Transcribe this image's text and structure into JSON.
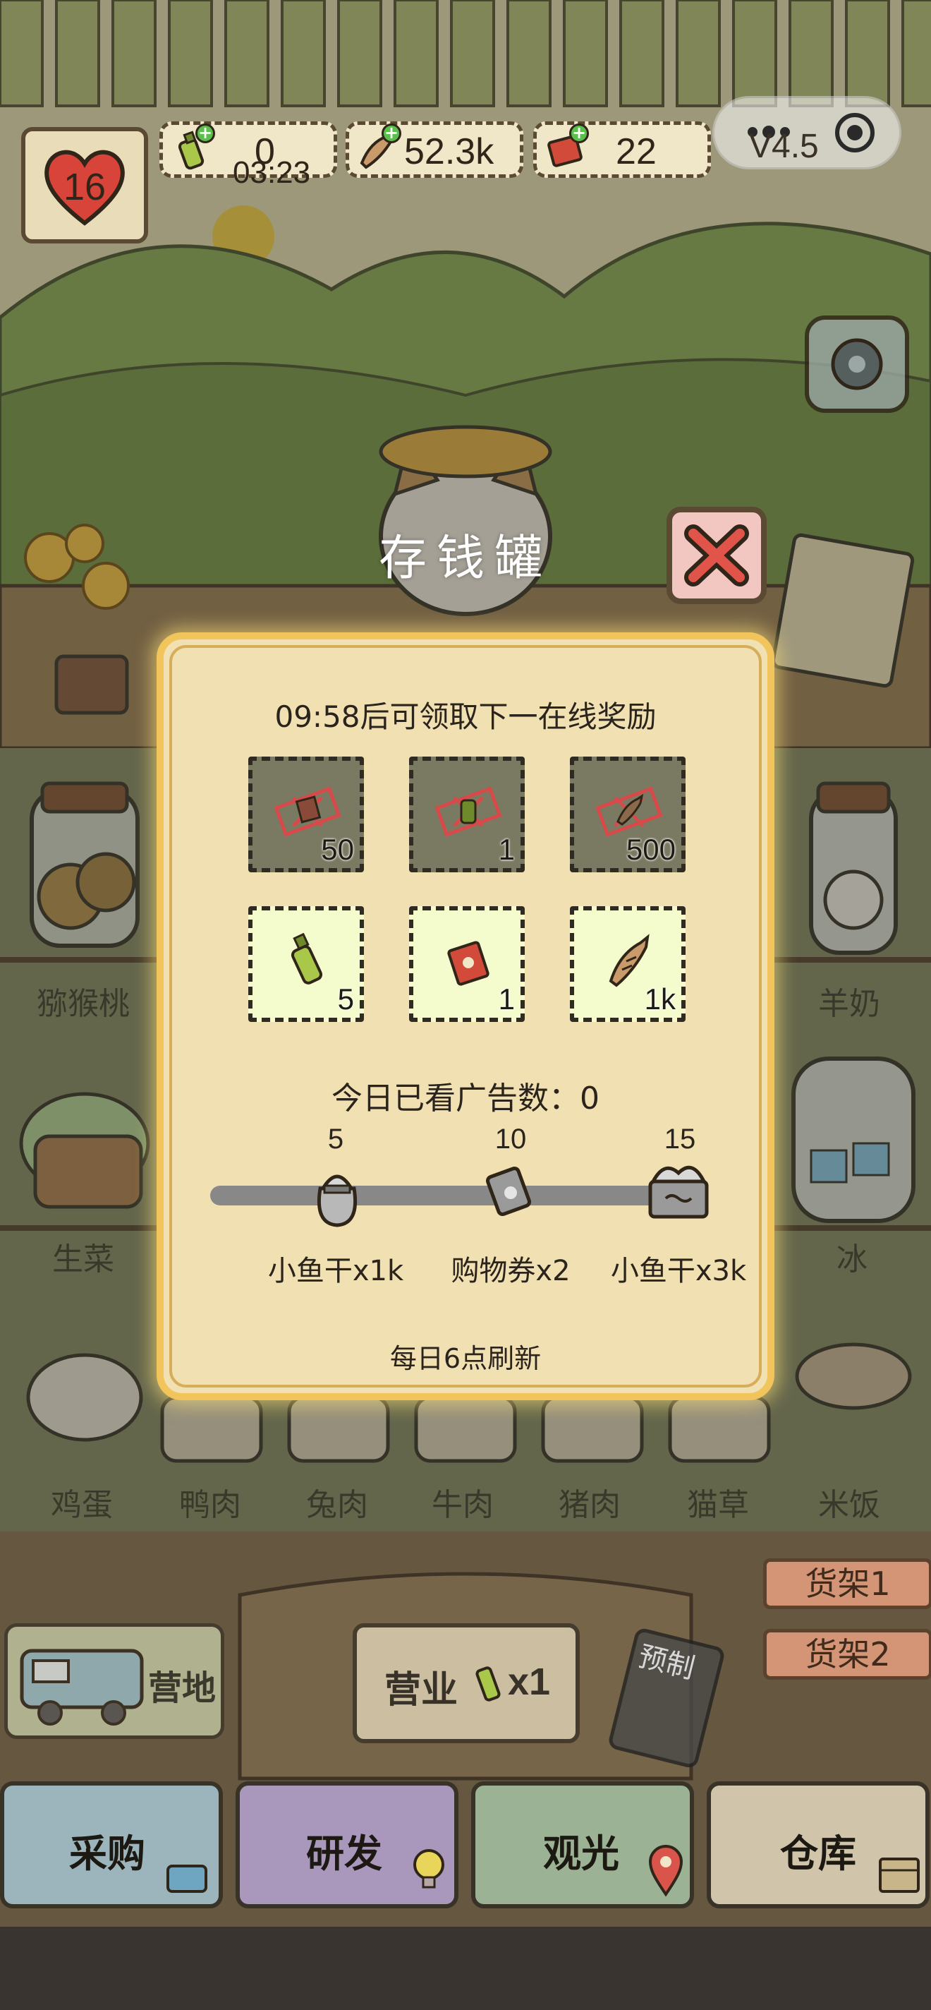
{
  "hud": {
    "hearts": "16",
    "currency_green": "0",
    "timer": "03:23",
    "fish": "52.3k",
    "tickets": "22",
    "version": "V4.5"
  },
  "modal": {
    "title": "存钱罐",
    "next_reward": "09:58后可领取下一在线奖励",
    "claimed_rewards": [
      {
        "item": "ticket",
        "count": "50"
      },
      {
        "item": "green-bottle",
        "count": "1"
      },
      {
        "item": "fish",
        "count": "500"
      }
    ],
    "open_rewards": [
      {
        "item": "green-bottle",
        "count": "5"
      },
      {
        "item": "ticket",
        "count": "1"
      },
      {
        "item": "fish",
        "count": "1k"
      }
    ],
    "ads_watched": "今日已看广告数：0",
    "milestones": [
      {
        "threshold": "5",
        "label": "小鱼干x1k"
      },
      {
        "threshold": "10",
        "label": "购物券x2"
      },
      {
        "threshold": "15",
        "label": "小鱼干x3k"
      }
    ],
    "progress": 0,
    "refresh": "每日6点刷新"
  },
  "background": {
    "left_items": [
      "猕猴桃",
      "生菜"
    ],
    "right_items": [
      "羊奶",
      "冰"
    ],
    "bottom_items": [
      "鸡蛋",
      "鸭肉",
      "兔肉",
      "牛肉",
      "猪肉",
      "猫草",
      "米饭"
    ]
  },
  "shelves": [
    "货架1",
    "货架2"
  ],
  "camp": "营地",
  "business": {
    "label": "营业",
    "multiplier": "x1"
  },
  "preorder": "预制",
  "nav": [
    {
      "label": "采购",
      "color": "#a9c9d6"
    },
    {
      "label": "研发",
      "color": "#b8a6d8"
    },
    {
      "label": "观光",
      "color": "#a7c7a7"
    },
    {
      "label": "仓库",
      "color": "#e8dcc1"
    }
  ]
}
